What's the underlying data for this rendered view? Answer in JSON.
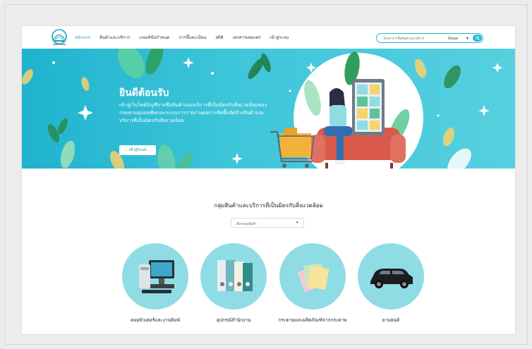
{
  "nav": {
    "menu": [
      {
        "label": "หน้าแรก",
        "active": true
      },
      {
        "label": "สินค้าและบริการ",
        "active": false
      },
      {
        "label": "เกณฑ์ข้อกำหนด",
        "active": false
      },
      {
        "label": "การขึ้นทะเบียน",
        "active": false
      },
      {
        "label": "สถิติ",
        "active": false
      },
      {
        "label": "เอกสารเผยแพร่",
        "active": false
      },
      {
        "label": "เข้าสู่ระบบ",
        "active": false
      }
    ],
    "search_placeholder": "ค้นหาจากชื่อสินค้าและบริการ",
    "search_filter": "ทั้งหมด",
    "accent": "#27b6d6"
  },
  "hero": {
    "title": "ยินดีต้อนรับ",
    "text": "เข้าสู่เว็บไซต์บัญชีรายชื่อสินค้าและบริการที่เป็นมิตรกับสิ่งแวดล้อมของกรมควบคุมมลพิษและระบบการรายงานผลการจัดซื้อจัดจ้างสินค้าและบริการที่เป็นมิตรกับสิ่งแวดล้อม",
    "button": "เข้าสู่ระบบ"
  },
  "section": {
    "title": "กลุ่มสินค้าและบริการที่เป็นมิตรกับสิ่งแวดล้อม",
    "dropdown_value": "เลือกกลุ่มสินค้า"
  },
  "categories": [
    {
      "label": "คอมพิวเตอร์และงานพิมพ์",
      "icon": "computer-icon"
    },
    {
      "label": "อุปกรณ์สำนักงาน",
      "icon": "binder-icon"
    },
    {
      "label": "กระดาษและผลิตภัณฑ์จากกระดาษ",
      "icon": "paper-icon"
    },
    {
      "label": "ยานยนต์",
      "icon": "car-icon"
    }
  ]
}
